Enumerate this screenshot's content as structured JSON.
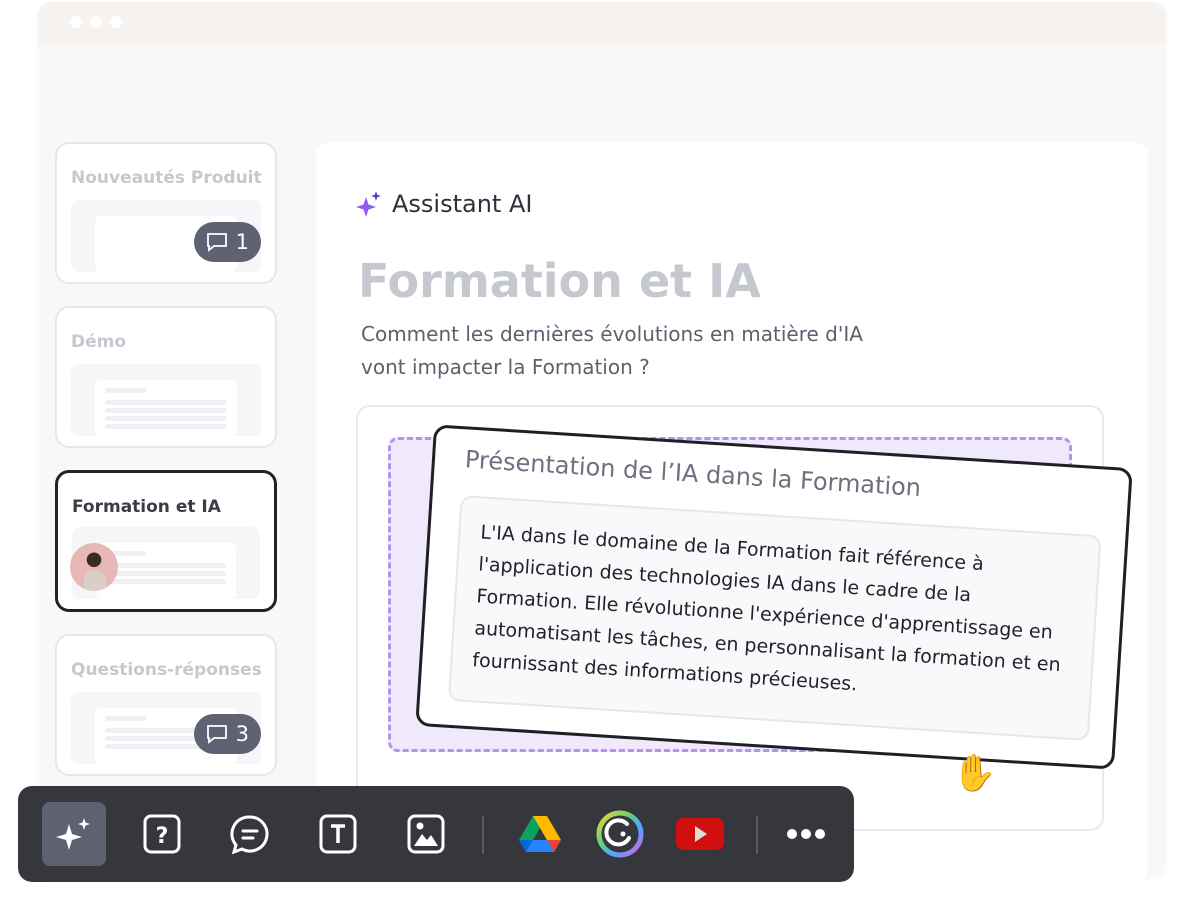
{
  "sidebar": {
    "slides": [
      {
        "title": "Nouveautés Produit",
        "comments": "1"
      },
      {
        "title": "Démo"
      },
      {
        "title": "Formation et IA"
      },
      {
        "title": "Questions-réponses",
        "comments": "3"
      }
    ]
  },
  "main": {
    "assistant_label": "Assistant AI",
    "title": "Formation et IA",
    "subtitle_line1": "Comment les dernières évolutions en matière d'IA",
    "subtitle_line2": "vont impacter la Formation ?",
    "card": {
      "title": "Présentation de l’IA dans la Formation",
      "body": "L'IA dans le domaine de la Formation fait référence à l'application des technologies IA dans le cadre de la Formation. Elle révolutionne l'expérience d'apprentissage en automatisant les tâches, en personnalisant la formation et en fournissant des informations précieuses."
    }
  },
  "toolbar": {
    "items": [
      "ai-sparkle-icon",
      "question-icon",
      "chat-icon",
      "text-icon",
      "image-icon",
      "google-drive-icon",
      "app-circle-icon",
      "youtube-icon",
      "more-icon"
    ]
  },
  "colors": {
    "accent": "#8b5cf6",
    "toolbar": "#36373c",
    "dash": "#b592ee"
  }
}
